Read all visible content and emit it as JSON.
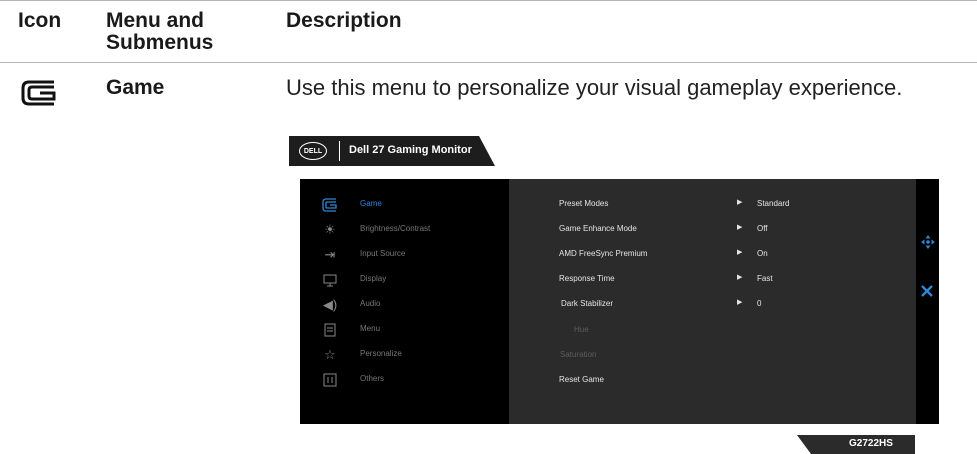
{
  "header": {
    "col_icon": "Icon",
    "col_menu": "Menu and Submenus",
    "col_desc": "Description"
  },
  "row": {
    "icon": "game-controller-icon",
    "name": "Game",
    "description": "Use this menu to personalize your visual gameplay experience."
  },
  "osd": {
    "brand": "DELL",
    "title": "Dell 27 Gaming Monitor",
    "accent_color": "#2f86d6",
    "menu": [
      {
        "label": "Game",
        "icon": "game-icon",
        "active": true
      },
      {
        "label": "Brightness/Contrast",
        "icon": "brightness-icon",
        "active": false
      },
      {
        "label": "Input Source",
        "icon": "input-source-icon",
        "active": false
      },
      {
        "label": "Display",
        "icon": "display-icon",
        "active": false
      },
      {
        "label": "Audio",
        "icon": "audio-icon",
        "active": false
      },
      {
        "label": "Menu",
        "icon": "menu-icon",
        "active": false
      },
      {
        "label": "Personalize",
        "icon": "star-icon",
        "active": false
      },
      {
        "label": "Others",
        "icon": "others-icon",
        "active": false
      }
    ],
    "settings": [
      {
        "label": "Preset Modes",
        "value": "Standard",
        "enabled": true
      },
      {
        "label": "Game Enhance Mode",
        "value": "Off",
        "enabled": true
      },
      {
        "label": "AMD FreeSync Premium",
        "value": "On",
        "enabled": true
      },
      {
        "label": "Response Time",
        "value": "Fast",
        "enabled": true
      },
      {
        "label": "Dark Stabilizer",
        "value": "0",
        "enabled": true
      },
      {
        "label": "Hue",
        "value": "",
        "enabled": false
      },
      {
        "label": "Saturation",
        "value": "",
        "enabled": false
      },
      {
        "label": "Reset Game",
        "value": "",
        "enabled": true
      }
    ],
    "model": "G2722HS"
  }
}
